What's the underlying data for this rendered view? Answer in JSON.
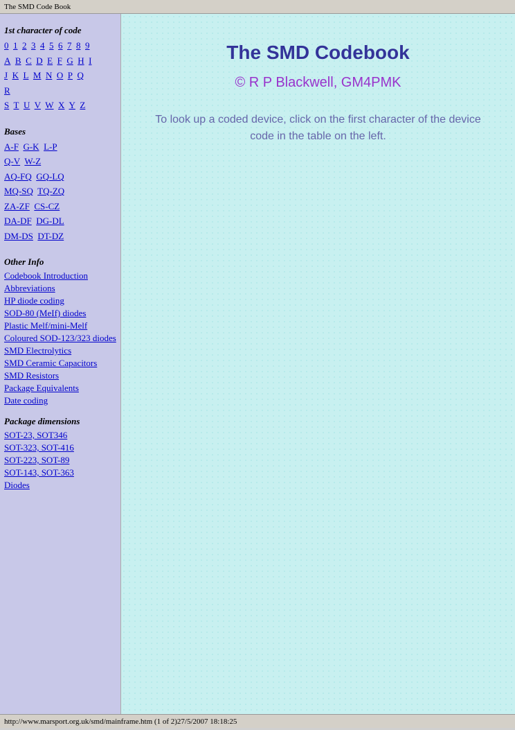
{
  "titleBar": {
    "text": "The SMD Code Book"
  },
  "sidebar": {
    "firstCharTitle": "1st character of code",
    "digits": {
      "row1": [
        "0",
        "1",
        "2",
        "3",
        "4",
        "5",
        "6",
        "7",
        "8",
        "9"
      ]
    },
    "letters": {
      "row1": [
        "A",
        "B",
        "C",
        "D",
        "E",
        "F",
        "G",
        "H",
        "I"
      ],
      "row2": [
        "J",
        "K",
        "L",
        "M",
        "N",
        "O",
        "P",
        "Q"
      ],
      "row3": [
        "R"
      ],
      "row4": [
        "S",
        "T",
        "U",
        "V",
        "W",
        "X",
        "Y",
        "Z"
      ]
    },
    "basesTitle": "Bases",
    "bases": [
      {
        "label": "A-F",
        "href": "#"
      },
      {
        "label": "G-K",
        "href": "#"
      },
      {
        "label": "L-P",
        "href": "#"
      },
      {
        "label": "Q-V",
        "href": "#"
      },
      {
        "label": "W-Z",
        "href": "#"
      },
      {
        "label": "AQ-FQ",
        "href": "#"
      },
      {
        "label": "GQ-LQ",
        "href": "#"
      },
      {
        "label": "MQ-SQ",
        "href": "#"
      },
      {
        "label": "TQ-ZQ",
        "href": "#"
      },
      {
        "label": "ZA-ZF",
        "href": "#"
      },
      {
        "label": "CS-CZ",
        "href": "#"
      },
      {
        "label": "DA-DF",
        "href": "#"
      },
      {
        "label": "DG-DL",
        "href": "#"
      },
      {
        "label": "DM-DS",
        "href": "#"
      },
      {
        "label": "DT-DZ",
        "href": "#"
      }
    ],
    "otherInfoTitle": "Other Info",
    "otherInfo": [
      {
        "label": "Codebook Introduction",
        "href": "#"
      },
      {
        "label": "Abbreviations",
        "href": "#"
      },
      {
        "label": "HP diode coding",
        "href": "#"
      },
      {
        "label": "SOD-80 (MeIf) diodes",
        "href": "#"
      },
      {
        "label": "Plastic Melf/mini-Melf",
        "href": "#"
      },
      {
        "label": "Coloured SOD-123/323 diodes",
        "href": "#"
      },
      {
        "label": "SMD Electrolytics",
        "href": "#"
      },
      {
        "label": "SMD Ceramic Capacitors",
        "href": "#"
      },
      {
        "label": "SMD Resistors",
        "href": "#"
      },
      {
        "label": "Package Equivalents",
        "href": "#"
      },
      {
        "label": "Date coding",
        "href": "#"
      }
    ],
    "packageDimsTitle": "Package dimensions",
    "packageDims": [
      {
        "label": "SOT-23, SOT346",
        "href": "#"
      },
      {
        "label": "SOT-323, SOT-416",
        "href": "#"
      },
      {
        "label": "SOT-223, SOT-89",
        "href": "#"
      },
      {
        "label": "SOT-143, SOT-363",
        "href": "#"
      },
      {
        "label": "Diodes",
        "href": "#"
      }
    ]
  },
  "content": {
    "title": "The SMD Codebook",
    "subtitle": "© R P Blackwell, GM4PMK",
    "description": "To look up a coded device, click on the first character of the device code in the table on the left."
  },
  "statusBar": {
    "text": "http://www.marsport.org.uk/smd/mainframe.htm (1 of 2)27/5/2007 18:18:25"
  }
}
